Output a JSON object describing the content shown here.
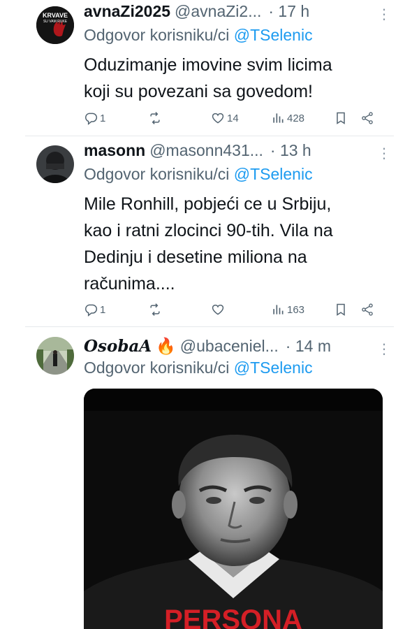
{
  "tweets": [
    {
      "name": "avnaZi2025",
      "handle": "@avnaZi2...",
      "time": "· 17 h",
      "reply_prefix": "Odgovor korisniku/ci",
      "reply_to": "@TSelenic",
      "text_lines": [
        "Oduzimanje imovine svim licima",
        "koji su povezani sa govedom!"
      ],
      "replies": "1",
      "retweets": "",
      "likes": "14",
      "views": "428",
      "avatar_text": [
        "KRVAVE",
        "SU VAM RUKE"
      ]
    },
    {
      "name": "masonn",
      "handle": "@masonn431...",
      "time": "· 13 h",
      "reply_prefix": "Odgovor korisniku/ci",
      "reply_to": "@TSelenic",
      "text_lines": [
        "Mile Ronhill, pobjeći  ce u Srbiju,",
        "kao i ratni zlocinci 90-tih. Vila na",
        "Dedinju i desetine miliona na",
        "računima...."
      ],
      "replies": "1",
      "retweets": "",
      "likes": "",
      "views": "163"
    },
    {
      "name": "OsobaA",
      "name_emoji": "🔥",
      "handle": "@ubaceniel...",
      "time": "· 14 m",
      "reply_prefix": "Odgovor korisniku/ci",
      "reply_to": "@TSelenic",
      "media_caption": "PERSONA"
    }
  ],
  "more_icon": "more-dots-icon",
  "colors": {
    "link": "#1d9bf0",
    "muted": "#536471",
    "text": "#0f1419",
    "caption": "#d41f26"
  }
}
